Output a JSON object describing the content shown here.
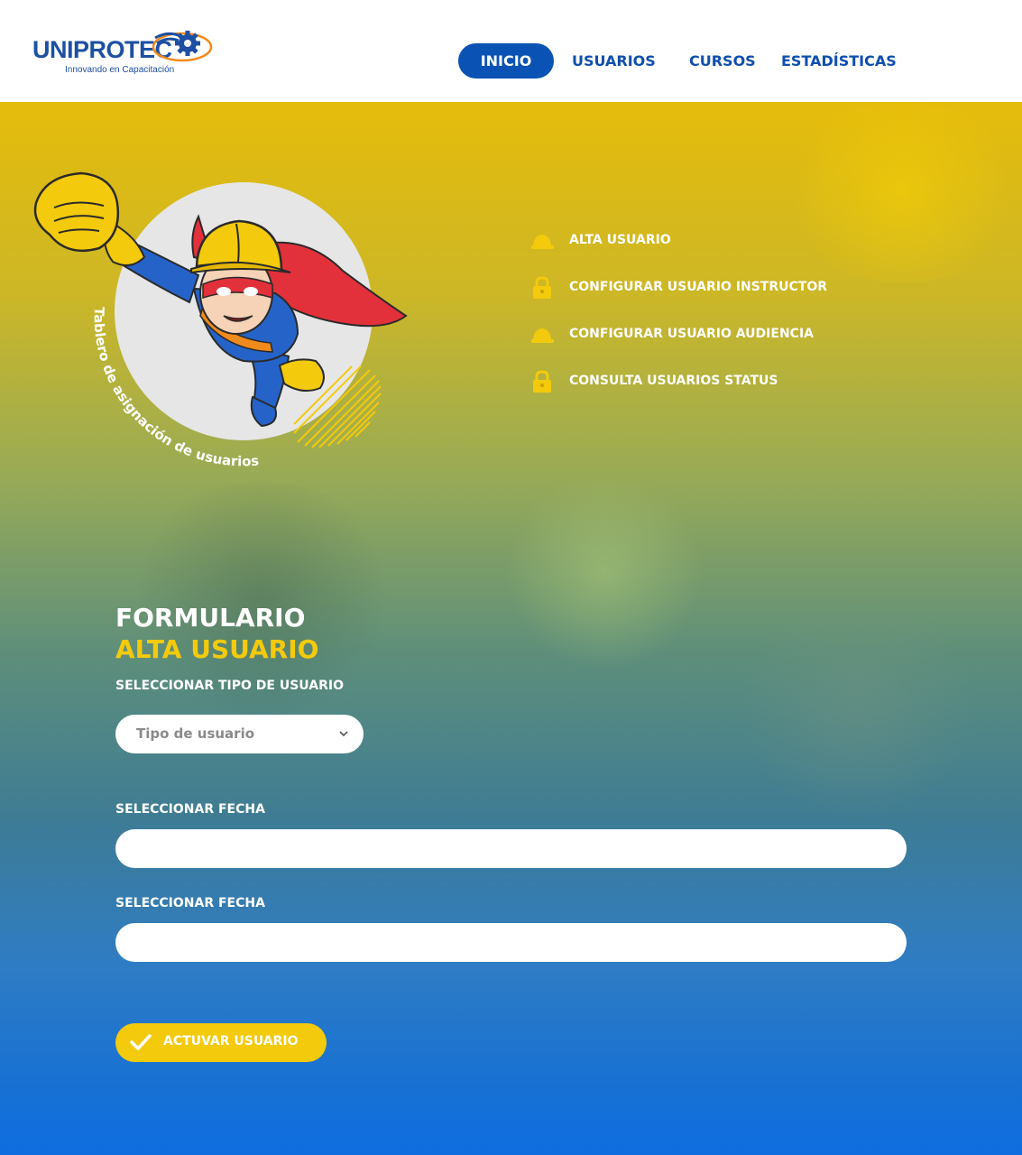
{
  "brand": {
    "name": "UNIPROTEC",
    "tagline": "Innovando en Capacitación",
    "primary_color": "#0a53b4",
    "accent_color": "#f3ca0c"
  },
  "nav": {
    "items": [
      {
        "label": "INICIO",
        "active": true
      },
      {
        "label": "USUARIOS",
        "active": false
      },
      {
        "label": "CURSOS",
        "active": false
      },
      {
        "label": "ESTADÍSTICAS",
        "active": false
      }
    ]
  },
  "hero": {
    "circular_text": "Tablero de asignación de usuarios",
    "illustration": "superhero-worker-with-helmet-and-cape"
  },
  "side_menu": {
    "items": [
      {
        "label": "ALTA USUARIO",
        "icon": "hard-hat-icon"
      },
      {
        "label": "CONFIGURAR USUARIO INSTRUCTOR",
        "icon": "lock-icon"
      },
      {
        "label": "CONFIGURAR USUARIO AUDIENCIA",
        "icon": "hard-hat-icon"
      },
      {
        "label": "CONSULTA USUARIOS STATUS",
        "icon": "lock-icon"
      }
    ]
  },
  "form": {
    "title": "FORMULARIO",
    "subtitle": "ALTA USUARIO",
    "user_type_label": "SELECCIONAR TIPO DE USUARIO",
    "user_type_placeholder": "Tipo de usuario",
    "date1_label": "SELECCIONAR FECHA",
    "date1_value": "",
    "date2_label": "SELECCIONAR FECHA",
    "date2_value": "",
    "submit_label": "ACTUVAR USUARIO"
  }
}
